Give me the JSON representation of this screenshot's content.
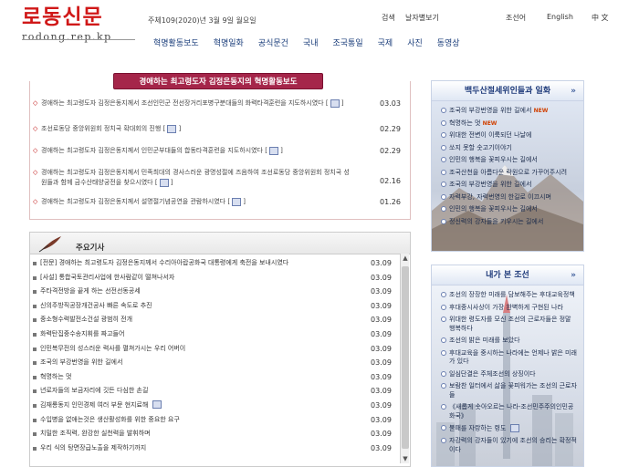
{
  "header": {
    "logo_title": "로동신문",
    "logo_url": "rodong.rep.kp",
    "date": "주체109(2020)년 3월 9일 월요일",
    "search": "검색",
    "date_view": "날자별보기",
    "languages": [
      "조선어",
      "English",
      "中 文"
    ]
  },
  "nav": [
    "혁명활동보도",
    "혁명일화",
    "공식문건",
    "국내",
    "조국통일",
    "국제",
    "사진",
    "동영상"
  ],
  "activity": {
    "title": "경애하는 최고령도자 김정은동지의 혁명활동보도",
    "items": [
      {
        "text": "경애하는 최고령도자 김정은동지께서 조선인민군 전선장거리포병구분대들의 화력타격훈련을 지도하시였다 [",
        "date": "03.03"
      },
      {
        "text": "조선로동당 중앙위원회 정치국 확대회의 진행 [",
        "date": "02.29"
      },
      {
        "text": "경애하는 최고령도자 김정은동지께서 인민군부대들의 합동타격훈련을 지도하시였다 [",
        "date": "02.29"
      },
      {
        "text": "경애하는 최고령도자 김정은동지께서 민족최대의 경사스러운 광명성절에 즈음하여 조선로동당 중앙위원회 정치국 성원들과 함께 금수산태양궁전을 찾으시였다 [",
        "date": "02.16"
      },
      {
        "text": "경애하는 최고령도자 김정은동지께서 설명절기념공연을 관람하시였다 [",
        "date": "01.26"
      }
    ]
  },
  "main": {
    "title": "주요기사",
    "items": [
      {
        "text": "[전문] 경애하는 최고령도자 김정은동지께서 수리아아랍공화국 대통령에게 축전을 보내시였다",
        "date": "03.09"
      },
      {
        "text": "[사설] 통합국토관리사업에 한사람같이 떨쳐나서자",
        "date": "03.09"
      },
      {
        "text": "주타격전방을 끝게 하는 선전선동공세",
        "date": "03.09"
      },
      {
        "text": "신의주방직공장개건공사 빠른 속도로 추진",
        "date": "03.09"
      },
      {
        "text": "중소형수력발전소건설 광범히 전개",
        "date": "03.09"
      },
      {
        "text": "화력탄집중수송지휘를 짜고들어",
        "date": "03.09"
      },
      {
        "text": "인민복무전의 성스러운 력사를 펼쳐가시는 우리 어버이",
        "date": "03.09"
      },
      {
        "text": "조국의 부강번영을 위한 길에서",
        "date": "03.09"
      },
      {
        "text": "혁명하는 멋",
        "date": "03.09"
      },
      {
        "text": "년로자들의 보금자리에 깃든 다심한 손길",
        "date": "03.09"
      },
      {
        "text": "김재룡동지 인민경제 여러 부문 현지료해",
        "date": "03.09"
      },
      {
        "text": "수입병을 없애는것은 생산활성화를 위한 중요한 요구",
        "date": "03.09"
      },
      {
        "text": "치밀한 조직력, 완강한 실천력을 발휘하며",
        "date": "03.09"
      },
      {
        "text": "우리 식의 탕면장급노출을 제작하기까지",
        "date": "03.09"
      }
    ]
  },
  "side1": {
    "title": "백두산절세위인들과 일화",
    "items": [
      {
        "text": "조국의 부강번영을 위한 길에서",
        "new": "NEW"
      },
      {
        "text": "혁명하는 멋",
        "new": "NEW"
      },
      {
        "text": "위대한 전변이 이룩되던 나날에",
        "new": ""
      },
      {
        "text": "쏘지 못할 숫고기이야기",
        "new": ""
      },
      {
        "text": "인민의 행복을 꽃피우시는 길에서",
        "new": ""
      },
      {
        "text": "조국산천을 아름다운 락원으로 가꾸어주시려",
        "new": ""
      },
      {
        "text": "조국의 부강번영을 위한 길에서",
        "new": ""
      },
      {
        "text": "자력부강, 자력번영의 한길로 이끄시며",
        "new": ""
      },
      {
        "text": "인민의 행복을 꽃피우시는 길에서",
        "new": ""
      },
      {
        "text": "정신력의 강자들을 키우시는 길에서",
        "new": ""
      }
    ]
  },
  "side2": {
    "title": "내가 본 조선",
    "items": [
      "조선의 장장한 미래를 담보해주는 후대교육정책",
      "후대중시사상이 가장 완벽하게 구현된 나라",
      "위대한 령도자를 모신 조선의 근로자들은 정말 행복하다",
      "조선의 밝은 미래를 보았다",
      "후대교육을 중시하는 나라에는 언제나 밝은 미래가 있다",
      "일심단결은 주체조선의 상징이다",
      "보람찬 일터에서 삶을 꽃피워가는 조선의 근로자들",
      "《새롭게 솟아오르는 나라-조선민주주의인민공화국》",
      "불패를 자랑하는 령도",
      "자강력의 강자들이 있기에 조선의 승리는 확정적이다"
    ]
  }
}
